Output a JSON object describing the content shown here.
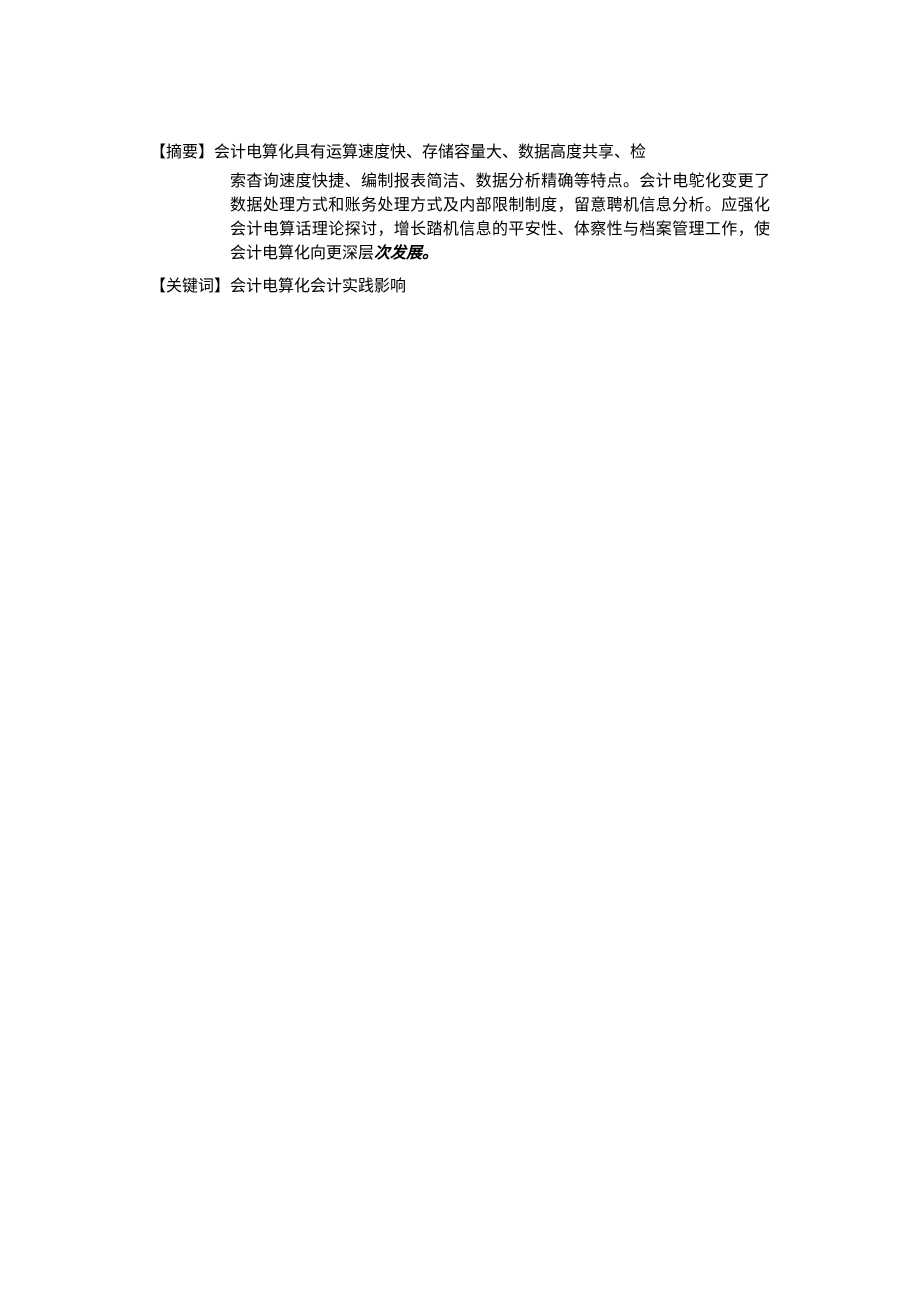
{
  "abstract": {
    "label": "【摘要】",
    "firstLineText": "会计电算化具有运算速度快、存储容量大、数据高度共享、检",
    "bodyLine1": "索杳询速度快捷、编制报表简洁、数据分析精确等特点。会计电鸵化变更了数据处理方式和账务处理方式及内部限制制度，留意聘机信息分析。应强化会计电算话理论探讨，增长踏机信息的平安性、体察性与档案管理工作，使会计电算化向更深层",
    "emphasis": "次发展。"
  },
  "keywords": {
    "label": "【关键词】",
    "text": "会计电算化会计实践影响"
  }
}
